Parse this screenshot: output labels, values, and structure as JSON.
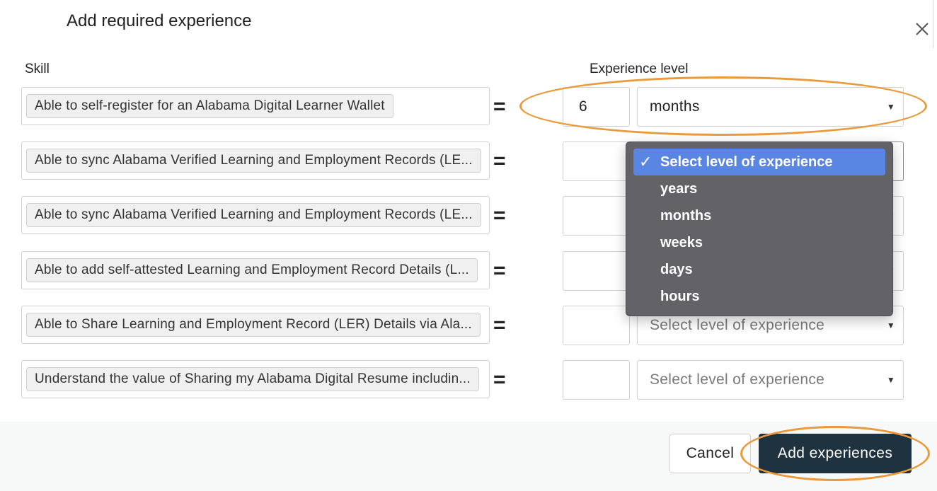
{
  "dialog": {
    "title": "Add required experience",
    "close_icon": "close-icon"
  },
  "columns": {
    "skill": "Skill",
    "experience_level": "Experience level"
  },
  "rows": [
    {
      "skill": "Able to self-register for an Alabama Digital Learner Wallet",
      "amount": "6",
      "unit": "months",
      "unit_placeholder": false
    },
    {
      "skill": "Able to sync Alabama Verified Learning and Employment Records (LE...",
      "amount": "",
      "unit": "",
      "unit_placeholder": false
    },
    {
      "skill": "Able to sync Alabama Verified Learning and Employment Records (LE...",
      "amount": "",
      "unit": "",
      "unit_placeholder": false
    },
    {
      "skill": "Able to add self-attested Learning and Employment Record Details (L...",
      "amount": "",
      "unit": "",
      "unit_placeholder": false
    },
    {
      "skill": "Able to Share Learning and Employment Record (LER) Details via Ala...",
      "amount": "",
      "unit": "Select level of experience",
      "unit_placeholder": true
    },
    {
      "skill": "Understand the value of Sharing my Alabama Digital Resume includin...",
      "amount": "",
      "unit": "Select level of experience",
      "unit_placeholder": true
    }
  ],
  "equals_symbol": "=",
  "dropdown": {
    "options": [
      "Select level of experience",
      "years",
      "months",
      "weeks",
      "days",
      "hours"
    ],
    "selected_index": 0,
    "checkmark": "✓"
  },
  "footer": {
    "cancel_label": "Cancel",
    "submit_label": "Add experiences"
  },
  "colors": {
    "annotation_ring": "#ea9a3a",
    "submit_button": "#1e3240",
    "dropdown_bg": "#636267",
    "dropdown_selected": "#5a86e3"
  }
}
